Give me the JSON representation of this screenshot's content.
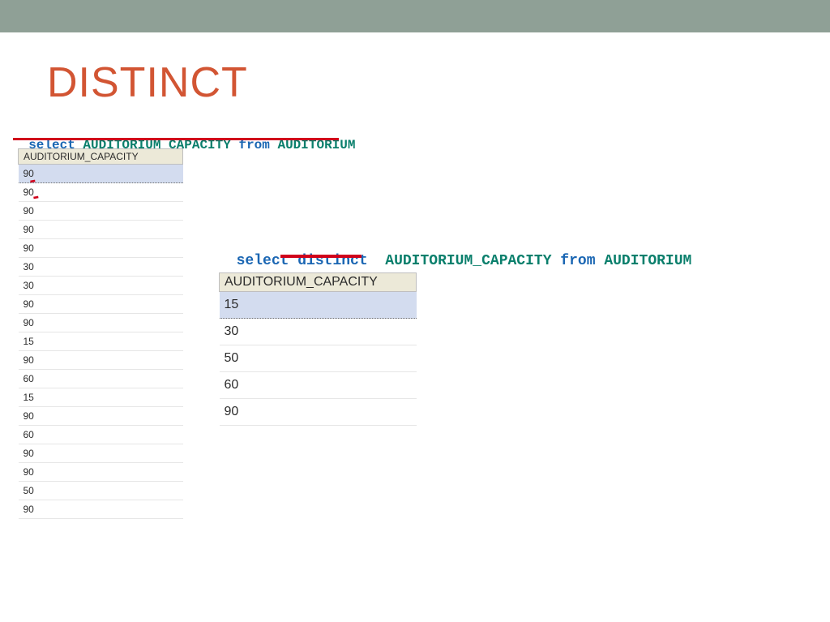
{
  "title": "DISTINCT",
  "sql1": {
    "select": "select ",
    "ident1": "AUDITORIUM_CAPACITY",
    "from": " from ",
    "ident2": "AUDITORIUM"
  },
  "sql2": {
    "select": "select ",
    "distinct": "distinct  ",
    "ident1": "AUDITORIUM_CAPACITY",
    "from": " from ",
    "ident2": "AUDITORIUM"
  },
  "table1": {
    "header": "AUDITORIUM_CAPACITY",
    "rows": [
      "90",
      "90",
      "90",
      "90",
      "90",
      "30",
      "30",
      "90",
      "90",
      "15",
      "90",
      "60",
      "15",
      "90",
      "60",
      "90",
      "90",
      "50",
      "90"
    ]
  },
  "table2": {
    "header": "AUDITORIUM_CAPACITY",
    "rows": [
      "15",
      "30",
      "50",
      "60",
      "90"
    ]
  }
}
